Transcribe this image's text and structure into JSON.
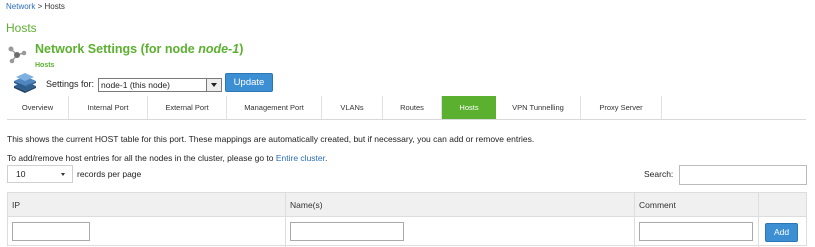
{
  "breadcrumb": {
    "link": "Network",
    "separator": " > ",
    "current": "Hosts"
  },
  "page_title": "Hosts",
  "section": {
    "title_prefix": "Network Settings (for node ",
    "title_node": "node-1",
    "title_suffix": ")",
    "subtitle": "Hosts",
    "icon": "network-nodes-icon"
  },
  "settings": {
    "label": "Settings for:",
    "selected_node": "node-1 (this node)",
    "update_label": "Update",
    "icon": "server-stack-icon"
  },
  "tabs": [
    {
      "label": "Overview",
      "active": false
    },
    {
      "label": "Internal Port",
      "active": false
    },
    {
      "label": "External Port",
      "active": false
    },
    {
      "label": "Management Port",
      "active": false
    },
    {
      "label": "VLANs",
      "active": false
    },
    {
      "label": "Routes",
      "active": false
    },
    {
      "label": "Hosts",
      "active": true
    },
    {
      "label": "VPN Tunnelling",
      "active": false
    },
    {
      "label": "Proxy Server",
      "active": false
    }
  ],
  "info": {
    "line1": "This shows the current HOST table for this port. These mappings are automatically created, but if necessary, you can add or remove entries.",
    "line2_prefix": "To add/remove host entries for all the nodes in the cluster, please go to ",
    "line2_link": "Entire cluster",
    "line2_suffix": "."
  },
  "table_controls": {
    "page_length": "10",
    "page_length_label": "records per page",
    "search_label": "Search:",
    "search_value": ""
  },
  "table": {
    "columns": [
      "IP",
      "Name(s)",
      "Comment",
      ""
    ],
    "add_label": "Add"
  },
  "colors": {
    "accent_green": "#5cb030",
    "button_blue": "#3d8fd3",
    "link_blue": "#2a6ebb"
  }
}
